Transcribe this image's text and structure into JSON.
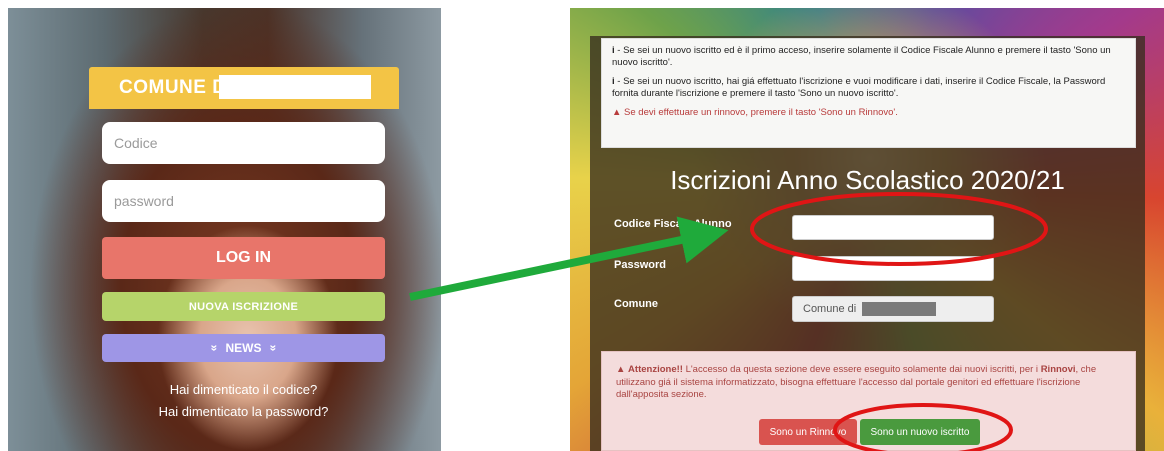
{
  "left": {
    "brand": "COMUNE DI",
    "code_placeholder": "Codice",
    "password_placeholder": "password",
    "login_label": "LOG IN",
    "new_registration_label": "NUOVA ISCRIZIONE",
    "news_label": "NEWS",
    "news_chevron": "»",
    "forgot_code": "Hai dimenticato il codice?",
    "forgot_password": "Hai dimenticato la password?"
  },
  "right": {
    "info_icon": "i",
    "info_1": " - Se sei un nuovo iscritto ed è il primo acceso, inserire solamente il Codice Fiscale Alunno e premere il tasto 'Sono un nuovo iscritto'.",
    "info_2": " - Se sei un nuovo iscritto, hai giá effettuato l'iscrizione e vuoi modificare i dati, inserire il Codice Fiscale, la Password fornita durante l'iscrizione e premere il tasto 'Sono un nuovo iscritto'.",
    "warn_icon": "▲",
    "warn_text": " Se devi effettuare un rinnovo, premere il tasto 'Sono un Rinnovo'.",
    "form_title": "Iscrizioni Anno Scolastico 2020/21",
    "label_cf": "Codice Fiscale Alunno",
    "label_password": "Password",
    "label_comune": "Comune",
    "comune_value": "Comune di",
    "alert_title": "Attenzione!!",
    "alert_text_1": " L'accesso da questa sezione deve essere eseguito solamente dai nuovi iscritti, per i ",
    "alert_rinnovi": "Rinnovi",
    "alert_text_2": ", che utilizzano giá il sistema informatizzato, bisogna effettuare l'accesso dal portale genitori ed effettuare l'iscrizione dall'apposita sezione.",
    "btn_rinnovo": "Sono un Rinnovo",
    "btn_nuovo": "Sono un nuovo iscritto"
  },
  "colors": {
    "brand_yellow": "#f3c445",
    "login_red": "#e8756a",
    "nuova_green": "#b6d46a",
    "news_purple": "#9e96e6",
    "arrow_green": "#1faa3b",
    "annotation_red": "#e01515",
    "btn_rinnovo": "#d9534f",
    "btn_nuovo": "#4a9a3e"
  }
}
